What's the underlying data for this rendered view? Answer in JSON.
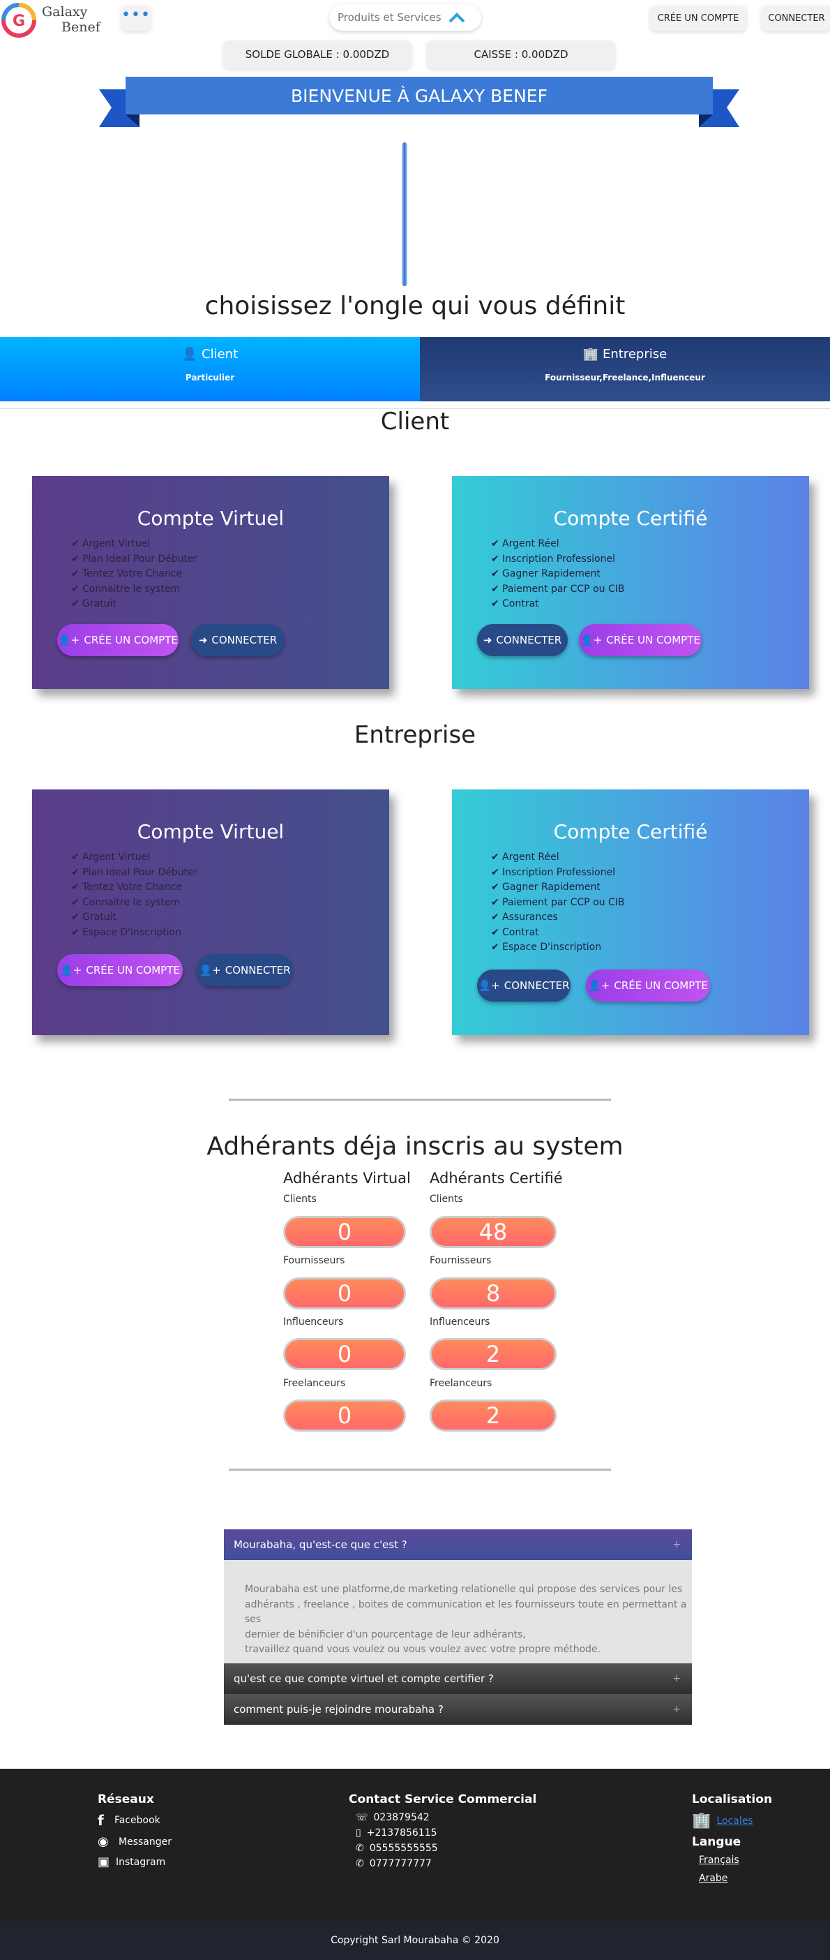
{
  "header": {
    "brand_line1": "Galaxy",
    "brand_line2": "Benef",
    "search_placeholder": "Produits et Services",
    "create_account": "CRÉE UN COMPTE",
    "connect": "CONNECTER",
    "balance_global": "SOLDE GLOBALE : 0.00DZD",
    "balance_caisse": "CAISSE : 0.00DZD"
  },
  "banner": {
    "title": "BIENVENUE À GALAXY BENEF"
  },
  "choose_title": "choisissez l'ongle qui vous définit",
  "tabs": [
    {
      "label": "Client",
      "sub": "Particulier",
      "icon": "user-icon"
    },
    {
      "label": "Entreprise",
      "sub": "Fournisseur,Freelance,Influenceur",
      "icon": "building-icon"
    }
  ],
  "sections": [
    {
      "title": "Client",
      "virtual": {
        "title": "Compte Virtuel",
        "features": [
          "Argent Virtuel",
          "Plan Ideal Pour Débuter",
          "Tentez Votre Chance",
          "Connaitre le system",
          "Gratuit"
        ],
        "btn_create": "CRÉE UN COMPTE",
        "btn_connect": "CONNECTER"
      },
      "certified": {
        "title": "Compte Certifié",
        "features": [
          "Argent Réel",
          "Inscription Professionel",
          "Gagner Rapidement",
          "Paiement par CCP ou CIB",
          "Contrat"
        ],
        "btn_connect": "CONNECTER",
        "btn_create": "CRÉE UN COMPTE"
      }
    },
    {
      "title": "Entreprise",
      "virtual": {
        "title": "Compte Virtuel",
        "features": [
          "Argent Virtuel",
          "Plan Ideal Pour Débuter",
          "Tentez Votre Chance",
          "Connaitre le system",
          "Gratuit",
          "Espace D'inscription"
        ],
        "btn_create": "CRÉE UN COMPTE",
        "btn_connect": "CONNECTER"
      },
      "certified": {
        "title": "Compte Certifié",
        "features": [
          "Argent Réel",
          "Inscription Professionel",
          "Gagner Rapidement",
          "Paiement par CCP ou CIB",
          "Assurances",
          "Contrat",
          "Espace D'inscription"
        ],
        "btn_connect": "CONNECTER",
        "btn_create": "CRÉE UN COMPTE"
      }
    }
  ],
  "stats": {
    "title": "Adhérants déja inscris au system",
    "virtual_title": "Adhérants Virtual",
    "certified_title": "Adhérants Certifié",
    "rows": [
      {
        "label": "Clients",
        "virtual": "0",
        "certified": "48"
      },
      {
        "label": "Fournisseurs",
        "virtual": "0",
        "certified": "8"
      },
      {
        "label": "Influenceurs",
        "virtual": "0",
        "certified": "2"
      },
      {
        "label": "Freelanceurs",
        "virtual": "0",
        "certified": "2"
      }
    ]
  },
  "faq": [
    {
      "q": "Mourabaha, qu'est-ce que c'est ?",
      "a_lines": [
        "Mourabaha est une platforme,de marketing relationelle qui propose des services pour les",
        "adhérants , freelance , boites de communication et les fournisseurs toute en permettant a ses",
        "dernier de bénificier d'un pourcentage de leur adhérants,",
        "travaillez quand vous voulez ou vous voulez avec votre propre méthode."
      ]
    },
    {
      "q": "qu'est ce que compte virtuel et compte certifier ?"
    },
    {
      "q": "comment puis-je rejoindre mourabaha ?"
    }
  ],
  "footer": {
    "reseaux_title": "Réseaux",
    "reseaux": [
      "Facebook",
      "Messanger",
      "Instagram"
    ],
    "contact_title": "Contact Service Commercial",
    "contacts": [
      "023879542",
      "+2137856115",
      "05555555555",
      "0777777777"
    ],
    "localisation_title": "Localisation",
    "localisation_link": "Locales",
    "langue_title": "Langue",
    "langues": [
      "Français",
      "Arabe"
    ],
    "copyright": "Copyright Sarl Mourabaha © 2020"
  }
}
